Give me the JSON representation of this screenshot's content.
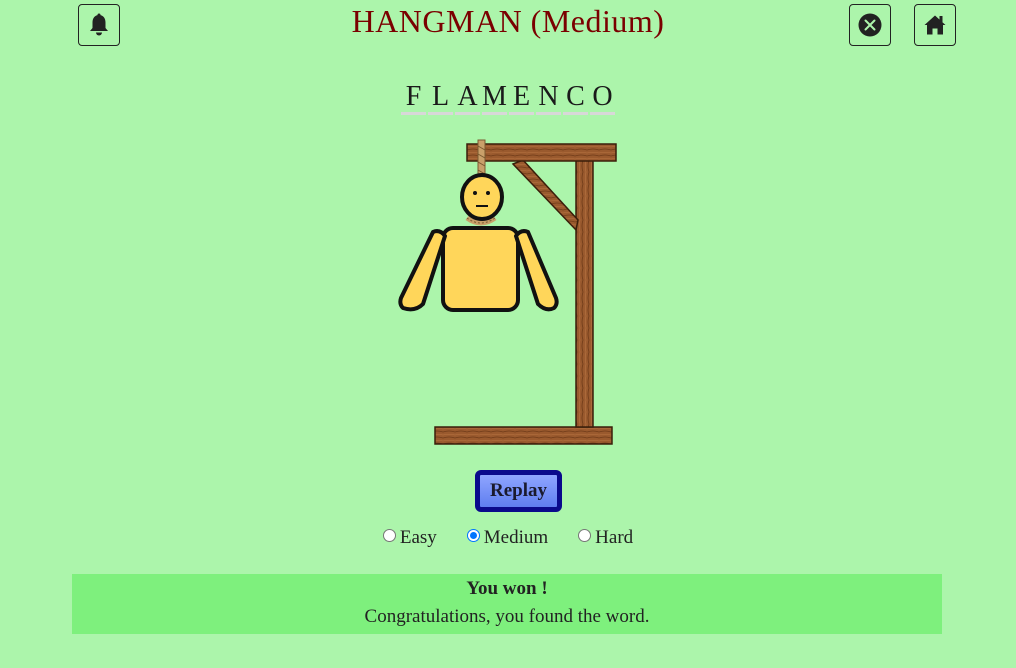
{
  "header": {
    "title": "HANGMAN (Medium)",
    "notifications_icon": "bell-icon",
    "close_icon": "close-circle-icon",
    "home_icon": "home-icon"
  },
  "game": {
    "word_letters": [
      "F",
      "L",
      "A",
      "M",
      "E",
      "N",
      "C",
      "O"
    ]
  },
  "controls": {
    "replay_label": "Replay"
  },
  "levels": {
    "options": [
      "Easy",
      "Medium",
      "Hard"
    ],
    "selected": "Medium"
  },
  "result": {
    "title": "You won !",
    "message": "Congratulations, you found the word."
  },
  "colors": {
    "background": "#acf5ab",
    "title": "#7a0000",
    "result_banner": "#7ef07d",
    "replay_border": "#0a0a8c",
    "wood": "#9a5a2e",
    "figure": "#ffd65a"
  }
}
